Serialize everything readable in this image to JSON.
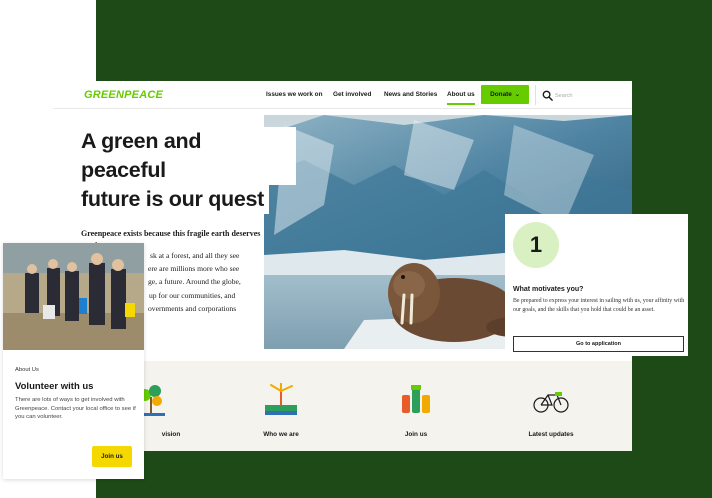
{
  "brand": {
    "logo_text": "GREENPEACE",
    "accent": "#66cc00",
    "background_green": "#1e4a17",
    "button_yellow": "#f5d800"
  },
  "nav": {
    "items": [
      {
        "label": "Issues we work on"
      },
      {
        "label": "Get involved"
      },
      {
        "label": "News and Stories"
      },
      {
        "label": "About us",
        "active": true
      }
    ],
    "donate_label": "Donate",
    "search_placeholder": "Search"
  },
  "hero": {
    "headline_line1": "A green and peaceful",
    "headline_line2": "future is our quest",
    "lead": "Greenpeace exists because this fragile earth deserves a voice.",
    "body_line1": "sk at a forest, and all they see",
    "body_line2": "ere are millions more who see",
    "body_line3": "ge, a future. Around the globe,",
    "body_line4": "up for our communities, and",
    "body_line5": "overnments and corporations"
  },
  "features": [
    {
      "label": "vision",
      "icon": "tree-icon"
    },
    {
      "label": "Who we are",
      "icon": "windmill-icon"
    },
    {
      "label": "Join us",
      "icon": "raised-fists-icon"
    },
    {
      "label": "Latest updates",
      "icon": "bicycle-icon"
    }
  ],
  "motive_card": {
    "step_number": "1",
    "title": "What motivates you?",
    "text": "Be prepared to express your interest in sailing with us, your affinity with our goals, and the skills that you hold that could be an asset.",
    "button_label": "Go to application"
  },
  "volunteer_card": {
    "eyebrow": "About Us",
    "title": "Volunteer with us",
    "text": "There are lots of ways to get involved with Greenpeace. Contact your local office to see if you can volunteer.",
    "button_label": "Join us"
  }
}
